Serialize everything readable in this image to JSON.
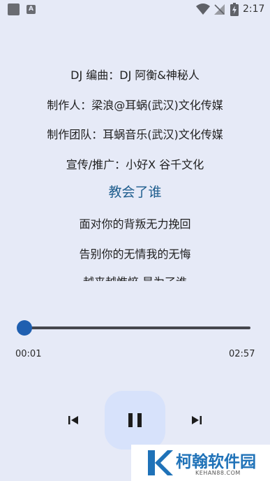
{
  "status_bar": {
    "time": "2:17",
    "a_badge": "A",
    "icons": [
      "notification-square-icon",
      "a-badge-icon",
      "wifi-icon",
      "no-signal-icon",
      "battery-charging-icon"
    ]
  },
  "lyrics": {
    "lines": [
      {
        "text": "DJ 编曲：DJ 阿衡&神秘人"
      },
      {
        "text": "制作人：梁浪@耳蜗(武汉)文化传媒"
      },
      {
        "text": "制作团队：耳蜗音乐(武汉)文化传媒"
      },
      {
        "text": "宣传/推广：小好X 谷千文化"
      },
      {
        "text": "教会了谁",
        "current": true
      },
      {
        "text": "面对你的背叛无力挽回"
      },
      {
        "text": "告别你的无情我的无悔"
      },
      {
        "text": "越来越憔悴 是为了谁"
      }
    ]
  },
  "player": {
    "elapsed": "00:01",
    "duration": "02:57",
    "progress_fraction": 0.006,
    "accent_color": "#1f5fb0",
    "controls": {
      "prev_icon": "skip-previous-icon",
      "play_icon": "pause-icon",
      "next_icon": "skip-next-icon"
    }
  },
  "watermark": {
    "title": "柯翰软件园",
    "subtitle": "KEHAN88.COM"
  }
}
